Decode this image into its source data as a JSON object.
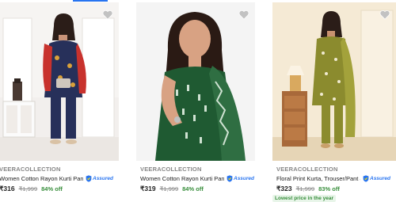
{
  "products": [
    {
      "brand": "VEERACOLLECTION",
      "title": "Women Cotton Rayon Kurti Pant ...",
      "assured_label": "Assured",
      "price": "₹316",
      "mrp": "₹1,999",
      "discount": "84% off",
      "image_icon": "woman-in-navy-floral-kurta-with-red-dupatta",
      "wishlist_icon": "heart-icon"
    },
    {
      "brand": "VEERACOLLECTION",
      "title": "Women Cotton Rayon Kurti Pant ...",
      "assured_label": "Assured",
      "price": "₹319",
      "mrp": "₹1,999",
      "discount": "84% off",
      "image_icon": "woman-in-green-printed-kurta-with-dupatta",
      "wishlist_icon": "heart-icon"
    },
    {
      "brand": "VEERACOLLECTION",
      "title": "Floral Print Kurta, Trouser/Pant & ...",
      "assured_label": "Assured",
      "price": "₹323",
      "mrp": "₹1,999",
      "discount": "83% off",
      "tag": "Lowest price in the year",
      "image_icon": "woman-in-olive-floral-kurta-set",
      "wishlist_icon": "heart-icon"
    }
  ],
  "colors": {
    "accent": "#2874f0",
    "discount_green": "#388e3c",
    "muted_text": "#878787",
    "primary_text": "#212121"
  }
}
